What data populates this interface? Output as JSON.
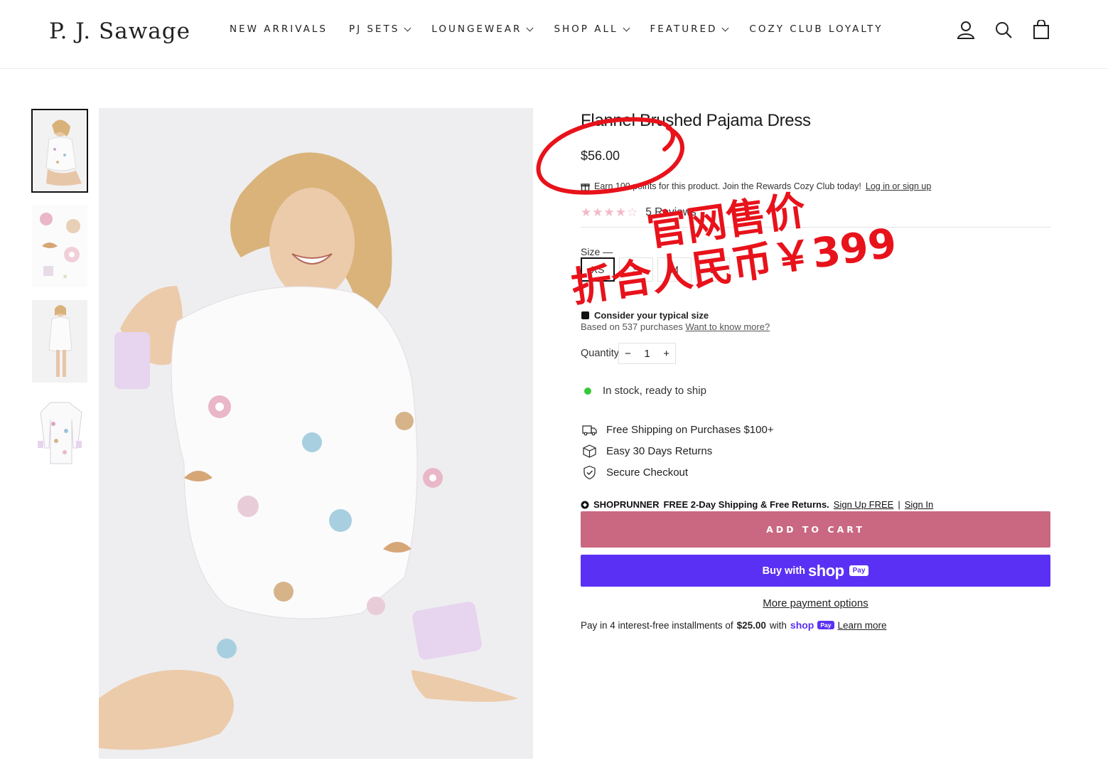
{
  "header": {
    "logo": "P. J. Sawage",
    "nav": [
      {
        "label": "NEW ARRIVALS",
        "dropdown": false
      },
      {
        "label": "PJ SETS",
        "dropdown": true
      },
      {
        "label": "LOUNGEWEAR",
        "dropdown": true
      },
      {
        "label": "SHOP ALL",
        "dropdown": true
      },
      {
        "label": "FEATURED",
        "dropdown": true
      },
      {
        "label": "COZY CLUB LOYALTY",
        "dropdown": false
      }
    ],
    "icons": [
      "account-icon",
      "search-icon",
      "cart-icon"
    ]
  },
  "gallery": {
    "thumbnails": [
      "thumb-model-front",
      "thumb-fabric-print",
      "thumb-model-full",
      "thumb-dress-flat"
    ],
    "active_index": 0
  },
  "product": {
    "title": "Flannel Brushed Pajama Dress",
    "price": "$56.00",
    "rewards_text": "Earn 100 points for this product. Join the Rewards Cozy Club today!",
    "rewards_link": "Log in or sign up",
    "rating": 4.5,
    "reviews_label": "5 Reviews",
    "size_label": "Size —",
    "sizes": [
      "XS",
      "S",
      "M",
      "L"
    ],
    "selected_size": "XS",
    "fit_title": "Consider your typical size",
    "fit_sub": "Based on 537 purchases",
    "fit_link": "Want to know more?",
    "quantity_label": "Quantity",
    "quantity": "1",
    "qty_minus": "−",
    "qty_plus": "+",
    "stock": "In stock, ready to ship",
    "perks": [
      {
        "icon": "truck-icon",
        "text": "Free Shipping on Purchases $100+"
      },
      {
        "icon": "box-icon",
        "text": "Easy 30 Days Returns"
      },
      {
        "icon": "shield-check-icon",
        "text": "Secure Checkout"
      }
    ],
    "shoprunner": {
      "brand": "SHOPRUNNER",
      "offer": "FREE 2-Day Shipping & Free Returns.",
      "signup": "Sign Up FREE",
      "sep": "|",
      "signin": "Sign In"
    },
    "add_to_cart": "ADD TO CART",
    "shop_pay": {
      "buy": "Buy with",
      "shop": "shop",
      "pay": "Pay"
    },
    "more_payment": "More payment options",
    "installments": {
      "pre": "Pay in 4 interest-free installments of",
      "amount": "$25.00",
      "with": "with",
      "shop": "shop",
      "pay": "Pay",
      "learn": "Learn more"
    }
  },
  "annotation": {
    "line1": "官网售价",
    "line2": "折合人民币￥399",
    "color": "#e8121b"
  },
  "colors": {
    "add_to_cart_bg": "#c96880",
    "shop_pay_bg": "#5a31f4",
    "stock_dot": "#37c837",
    "star": "#f3b9c7"
  }
}
